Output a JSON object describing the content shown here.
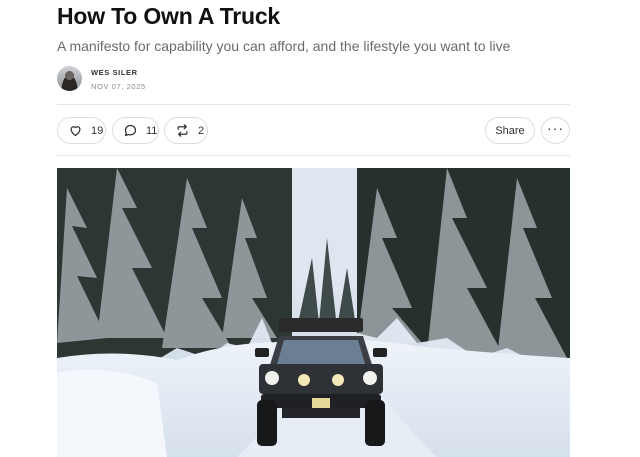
{
  "article": {
    "title": "How To Own A Truck",
    "subtitle": "A manifesto for capability you can afford, and the lifestyle you want to live"
  },
  "byline": {
    "author": "WES SILER",
    "date": "NOV 07, 2025"
  },
  "actions": {
    "likes": "19",
    "comments": "11",
    "restacks": "2",
    "share_label": "Share",
    "more_label": "···"
  },
  "icons": [
    "heart-icon",
    "comment-icon",
    "restack-icon",
    "more-icon"
  ],
  "colors": {
    "text": "#111111",
    "muted": "#6b6b6b",
    "border": "#dcdcdc"
  }
}
